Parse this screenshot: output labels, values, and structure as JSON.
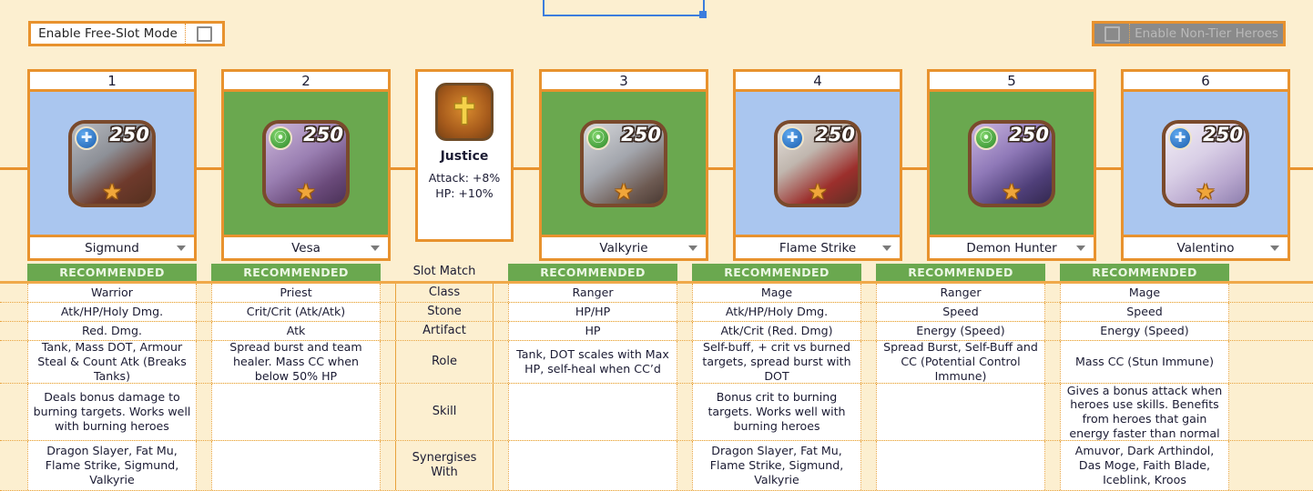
{
  "toolbar": {
    "free_slot_label": "Enable Free-Slot Mode",
    "free_slot_checked": false,
    "non_tier_label": "Enable Non-Tier Heroes",
    "non_tier_checked": false,
    "non_tier_disabled": true
  },
  "artifact": {
    "name": "Justice",
    "attack": "Attack: +8%",
    "hp": "HP: +10%"
  },
  "row_labels": {
    "slot_match": "Slot Match",
    "class": "Class",
    "stone": "Stone",
    "artifact": "Artifact",
    "role": "Role",
    "skill": "Skill",
    "synergises": "Synergises\nWith",
    "synergises_line1": "Synergises",
    "synergises_line2": "With"
  },
  "colors": {
    "page_bg": "#fcefd0",
    "accent_orange": "#e8922e",
    "recommended_green": "#6aa84f",
    "light_faction_bg": "#aac6ef",
    "nature_faction_bg": "#6aa84f",
    "selection_blue": "#3b7ddd",
    "disabled_grey": "#8a8a8a"
  },
  "slots": [
    {
      "number": "1",
      "hero": "Sigmund",
      "level": "250",
      "faction": "light-faction-icon",
      "faction_bg": "#aac6ef",
      "slot_match": "RECOMMENDED",
      "class": "Warrior",
      "stone": "Atk/HP/Holy Dmg.",
      "artifact": "Red. Dmg.",
      "role": "Tank, Mass DOT, Armour Steal & Count Atk (Breaks Tanks)",
      "skill": "Deals bonus damage to burning targets. Works well with burning heroes",
      "synergises": "Dragon Slayer, Fat Mu, Flame Strike, Sigmund, Valkyrie"
    },
    {
      "number": "2",
      "hero": "Vesa",
      "level": "250",
      "faction": "nature-faction-icon",
      "faction_bg": "#6aa84f",
      "slot_match": "RECOMMENDED",
      "class": "Priest",
      "stone": "Crit/Crit (Atk/Atk)",
      "artifact": "Atk",
      "role": "Spread burst and team healer. Mass CC when below 50% HP",
      "skill": "",
      "synergises": ""
    },
    {
      "number": "3",
      "hero": "Valkyrie",
      "level": "250",
      "faction": "nature-faction-icon",
      "faction_bg": "#6aa84f",
      "slot_match": "RECOMMENDED",
      "class": "Ranger",
      "stone": "HP/HP",
      "artifact": "HP",
      "role": "Tank, DOT scales with Max HP, self-heal when CC’d",
      "skill": "",
      "synergises": ""
    },
    {
      "number": "4",
      "hero": "Flame Strike",
      "level": "250",
      "faction": "light-faction-icon",
      "faction_bg": "#aac6ef",
      "slot_match": "RECOMMENDED",
      "class": "Mage",
      "stone": "Atk/HP/Holy Dmg.",
      "artifact": "Atk/Crit (Red. Dmg)",
      "role": "Self-buff, + crit vs burned targets, spread burst with DOT",
      "skill": "Bonus crit to burning targets. Works well with burning heroes",
      "synergises": "Dragon Slayer, Fat Mu, Flame Strike, Sigmund, Valkyrie"
    },
    {
      "number": "5",
      "hero": "Demon Hunter",
      "level": "250",
      "faction": "nature-faction-icon",
      "faction_bg": "#6aa84f",
      "slot_match": "RECOMMENDED",
      "class": "Ranger",
      "stone": "Speed",
      "artifact": "Energy (Speed)",
      "role": "Spread Burst, Self-Buff and CC (Potential Control Immune)",
      "skill": "",
      "synergises": ""
    },
    {
      "number": "6",
      "hero": "Valentino",
      "level": "250",
      "faction": "light-faction-icon",
      "faction_bg": "#aac6ef",
      "slot_match": "RECOMMENDED",
      "class": "Mage",
      "stone": "Speed",
      "artifact": "Energy (Speed)",
      "role": "Mass CC (Stun Immune)",
      "skill": "Gives a bonus attack when heroes use skills. Benefits from heroes that gain energy faster than normal",
      "synergises": "Amuvor, Dark Arthindol, Das Moge, Faith Blade, Iceblink, Kroos"
    }
  ]
}
